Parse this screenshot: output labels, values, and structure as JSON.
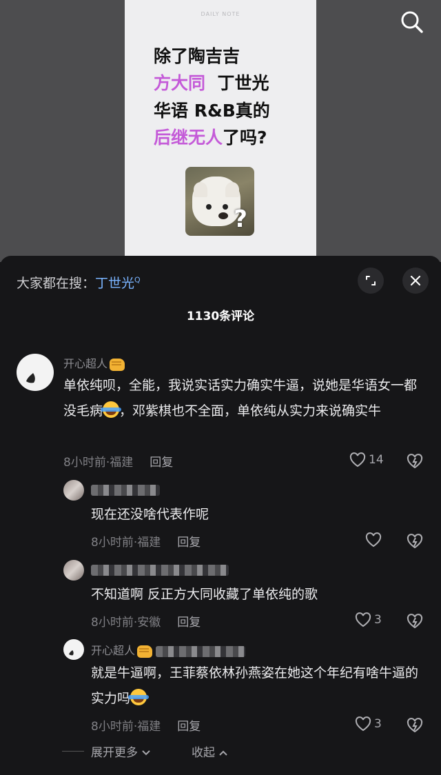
{
  "poster": {
    "brand": "DAILY NOTE",
    "line1": "除了陶吉吉",
    "line2_hl": "方大同",
    "line2_rest": "丁世光",
    "line3": "华语 R&B真的",
    "line4_hl": "后继无人",
    "line4_rest": "了吗?",
    "meme_mark": "?"
  },
  "header": {
    "hot_search_label": "大家都在搜：",
    "hot_search_term": "丁世光",
    "hot_search_sup": "Q",
    "comment_count": "1130条评论"
  },
  "comments": [
    {
      "user": "开心超人",
      "text_part1": "单依纯呗，全能，我说实话实力确实牛逼，说她是华语女一都没毛病",
      "text_part2": "，邓紫棋也不全面，单依纯从实力来说确实牛",
      "time_location": "8小时前·福建",
      "reply_label": "回复",
      "likes": "14"
    },
    {
      "text": "现在还没啥代表作呢",
      "time_location": "8小时前·福建",
      "reply_label": "回复",
      "likes": ""
    },
    {
      "text": "不知道啊 反正方大同收藏了单依纯的歌",
      "time_location": "8小时前·安徽",
      "reply_label": "回复",
      "likes": "3"
    },
    {
      "user": "开心超人",
      "text": "就是牛逼啊，王菲蔡依林孙燕姿在她这个年纪有啥牛逼的实力吗",
      "time_location": "8小时前·福建",
      "reply_label": "回复",
      "likes": "3"
    }
  ],
  "footer": {
    "expand_label": "展开更多",
    "collapse_label": "收起"
  },
  "colors": {
    "highlight": "#c45ad8",
    "link": "#7ab4ff",
    "background": "#161618"
  }
}
